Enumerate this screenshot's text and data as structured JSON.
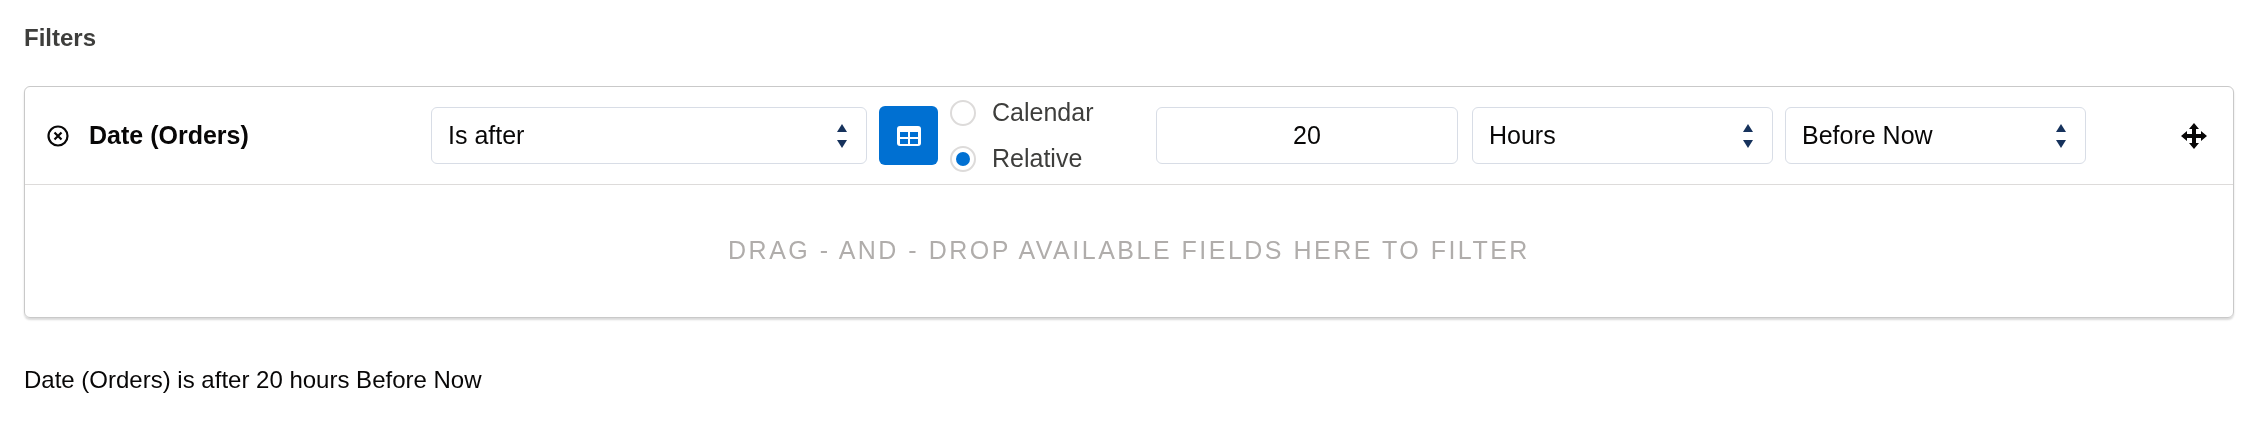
{
  "section_title": "Filters",
  "filter": {
    "field": "Date (Orders)",
    "operator": "Is after",
    "mode_options": [
      {
        "label": "Calendar",
        "selected": false
      },
      {
        "label": "Relative",
        "selected": true
      }
    ],
    "amount": "20",
    "unit": "Hours",
    "direction": "Before Now"
  },
  "drop_zone_hint": "DRAG - AND - DROP AVAILABLE FIELDS HERE TO FILTER",
  "summary": "Date (Orders) is after 20 hours Before Now"
}
